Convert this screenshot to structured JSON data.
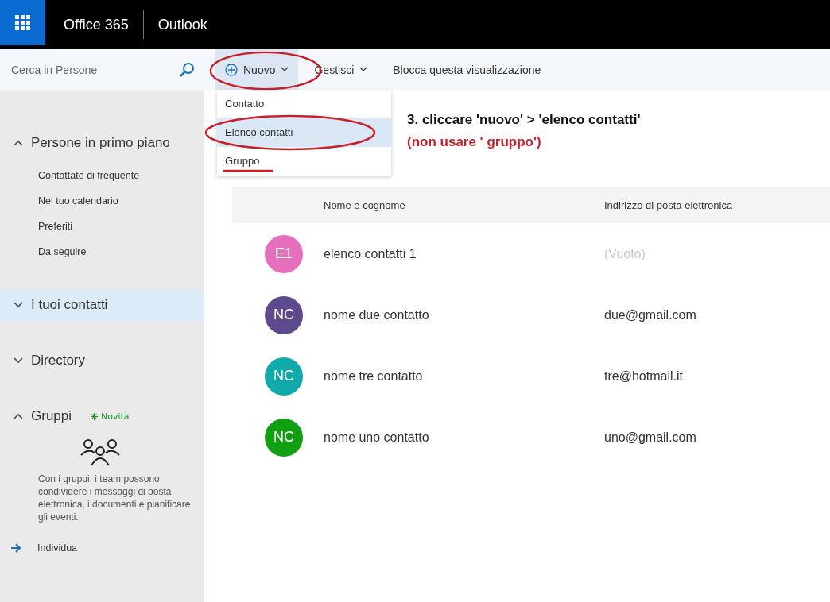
{
  "top_bar": {
    "suite": "Office 365",
    "app": "Outlook"
  },
  "search": {
    "placeholder": "Cerca in Persone"
  },
  "toolbar": [
    {
      "label": "Nuovo",
      "kind": "new",
      "expanded": true
    },
    {
      "label": "Gestisci",
      "kind": "menu",
      "expanded": false
    },
    {
      "label": "Blocca questa visualizzazione",
      "kind": "plain",
      "expanded": false
    }
  ],
  "new_menu": [
    {
      "label": "Contatto",
      "selected": false,
      "struck": false
    },
    {
      "label": "Elenco contatti",
      "selected": true,
      "struck": false
    },
    {
      "label": "Gruppo",
      "selected": false,
      "struck": true
    }
  ],
  "sidebar": {
    "sections": [
      {
        "label": "Persone in primo piano",
        "expanded": true,
        "selected": false,
        "items": [
          "Contattate di frequente",
          "Nel tuo calendario",
          "Preferiti",
          "Da seguire"
        ]
      },
      {
        "label": "I tuoi contatti",
        "expanded": false,
        "selected": true
      },
      {
        "label": "Directory",
        "expanded": false,
        "selected": false
      },
      {
        "label": "Gruppi",
        "expanded": true,
        "selected": false,
        "badge": "Novità",
        "description": "Con i gruppi, i team possono condividere i messaggi di posta elettronica, i documenti e pianificare gli eventi.",
        "link": "Individua"
      }
    ]
  },
  "annotation": {
    "step": "3. cliccare 'nuovo' > 'elenco contatti'",
    "warning": "(non usare ' gruppo')"
  },
  "table": {
    "columns": [
      "Nome e cognome",
      "Indirizzo di posta elettronica"
    ],
    "rows": [
      {
        "initials": "E1",
        "color": "#e36fbd",
        "name": "elenco contatti 1",
        "email": "(Vuoto)",
        "empty": true
      },
      {
        "initials": "NC",
        "color": "#5c4a8c",
        "name": "nome due contatto",
        "email": "due@gmail.com",
        "empty": false
      },
      {
        "initials": "NC",
        "color": "#11aaaa",
        "name": "nome tre contatto",
        "email": "tre@hotmail.it",
        "empty": false
      },
      {
        "initials": "NC",
        "color": "#12a012",
        "name": "nome uno contatto",
        "email": "uno@gmail.com",
        "empty": false
      }
    ]
  }
}
